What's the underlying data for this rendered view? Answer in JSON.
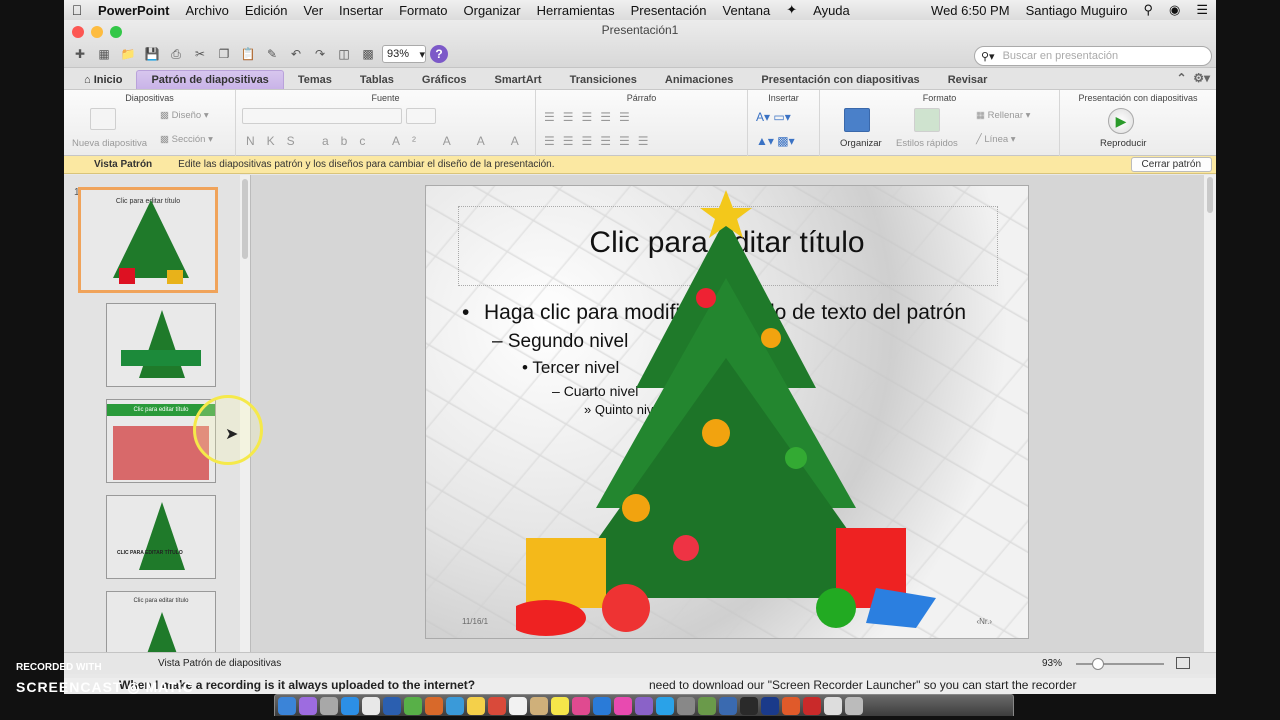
{
  "menubar": {
    "app": "PowerPoint",
    "items": [
      "Archivo",
      "Edición",
      "Ver",
      "Insertar",
      "Formato",
      "Organizar",
      "Herramientas",
      "Presentación",
      "Ventana",
      "Ayuda"
    ],
    "clock": "Wed 6:50 PM",
    "user": "Santiago Muguiro"
  },
  "window": {
    "title": "Presentación1",
    "zoom": "93%",
    "search_placeholder": "Buscar en presentación"
  },
  "tabs": [
    {
      "label": "Inicio"
    },
    {
      "label": "Patrón de diapositivas"
    },
    {
      "label": "Temas"
    },
    {
      "label": "Tablas"
    },
    {
      "label": "Gráficos"
    },
    {
      "label": "SmartArt"
    },
    {
      "label": "Transiciones"
    },
    {
      "label": "Animaciones"
    },
    {
      "label": "Presentación con diapositivas"
    },
    {
      "label": "Revisar"
    }
  ],
  "ribbon": {
    "groups": {
      "diapositivas": "Diapositivas",
      "fuente": "Fuente",
      "parrafo": "Párrafo",
      "insertar": "Insertar",
      "formato": "Formato",
      "presentacion": "Presentación con diapositivas"
    },
    "nueva_diapositiva": "Nueva diapositiva",
    "diseno": "Diseño",
    "seccion": "Sección",
    "organizar": "Organizar",
    "estilos_rapidos": "Estilos rápidos",
    "rellenar": "Rellenar",
    "linea": "Línea",
    "reproducir": "Reproducir"
  },
  "notice": {
    "label": "Vista Patrón",
    "text": "Edite las diapositivas patrón y los diseños para cambiar el diseño de la presentación.",
    "button": "Cerrar patrón"
  },
  "slide": {
    "title": "Clic para editar título",
    "body": [
      "Haga clic para modificar el estilo de texto del patrón",
      "Segundo nivel",
      "Tercer nivel",
      "Cuarto nivel",
      "Quinto nivel"
    ],
    "date": "11/16/1",
    "number": "‹Nr.›"
  },
  "thumbs": [
    {
      "num": "1",
      "title": "Clic para editar título"
    },
    {
      "num": "",
      "title": ""
    },
    {
      "num": "",
      "title": "Clic para editar título"
    },
    {
      "num": "",
      "title": "CLIC PARA EDITAR TÍTULO"
    },
    {
      "num": "",
      "title": "Clic para editar título"
    }
  ],
  "status": {
    "view": "Vista Patrón de diapositivas",
    "zoom": "93%"
  },
  "caption": {
    "left": "When I make a recording is it always uploaded to the internet?",
    "right": "need to download our \"Screen Recorder Launcher\" so you can start the recorder"
  },
  "watermark": {
    "line1": "RECORDED WITH",
    "line2": "SCREENCAST",
    "line3": "MATIC"
  },
  "colors": {
    "accent": "#c9b3e8",
    "notice": "#fbe8a2",
    "selection": "#f0a35a",
    "tree": "#1f7a2a"
  }
}
